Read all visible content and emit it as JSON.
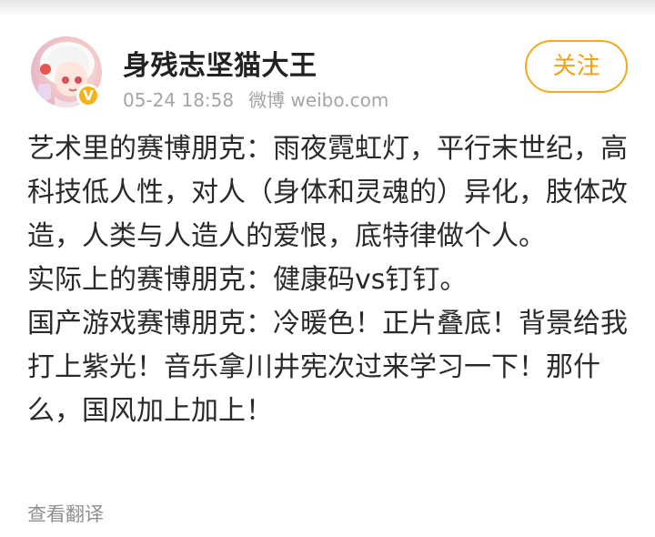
{
  "post": {
    "author": {
      "name": "身残志坚猫大王",
      "verified_mark": "V"
    },
    "timestamp": "05-24 18:58",
    "source": "微博 weibo.com",
    "follow_label": "关注",
    "paragraphs": [
      "艺术里的赛博朋克：雨夜霓虹灯，平行末世纪，高科技低人性，对人（身体和灵魂的）异化，肢体改造，人类与人造人的爱恨，底特律做个人。",
      "实际上的赛博朋克：健康码vs钉钉。",
      "国产游戏赛博朋克：冷暖色！正片叠底！背景给我打上紫光！音乐拿川井宪次过来学习一下！那什么，国风加上加上！"
    ],
    "translate_label": "查看翻译"
  },
  "colors": {
    "accent": "#f3a014",
    "verified_badge": "#f6b317",
    "meta_text": "#a5a5a5",
    "body_text": "#2a2a2a"
  },
  "icons": {
    "avatar": "anime-avatar-icon",
    "verified": "verified-badge-icon"
  }
}
